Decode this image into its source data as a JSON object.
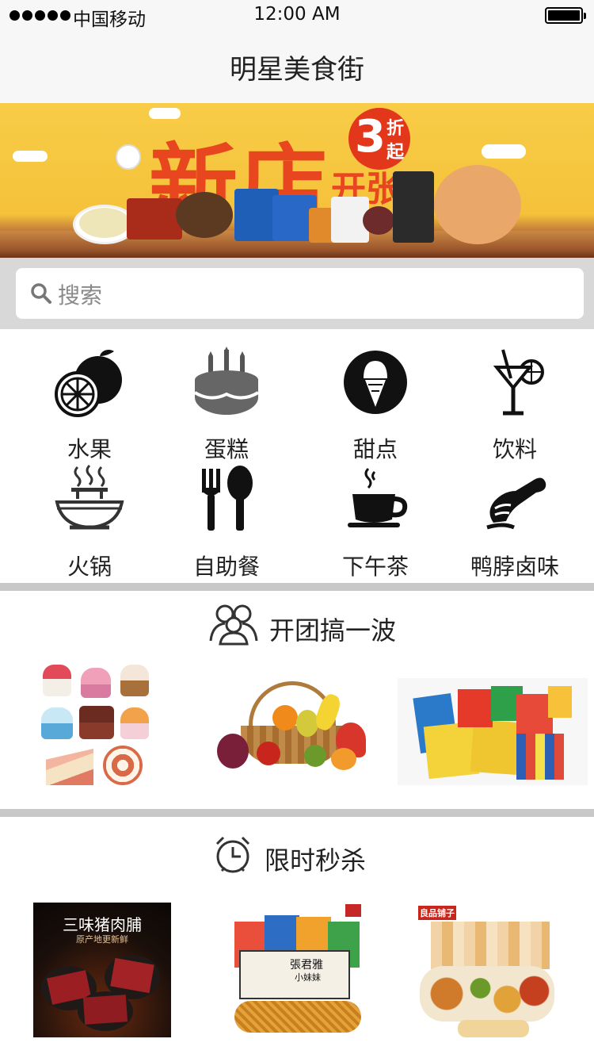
{
  "status_bar": {
    "carrier": "中国移动",
    "time": "12:00 AM",
    "battery_level": 1.0
  },
  "nav": {
    "title": "明星美食街"
  },
  "banner": {
    "headline": "新店",
    "subline": "开张",
    "discount_number": "3",
    "discount_char_1": "折",
    "discount_char_2": "起"
  },
  "search": {
    "placeholder": "搜索"
  },
  "categories": [
    {
      "label": "水果",
      "icon": "orange-icon"
    },
    {
      "label": "蛋糕",
      "icon": "cake-icon"
    },
    {
      "label": "甜点",
      "icon": "ice-cream-icon"
    },
    {
      "label": "饮料",
      "icon": "cocktail-icon"
    },
    {
      "label": "火锅",
      "icon": "hotpot-icon"
    },
    {
      "label": "自助餐",
      "icon": "fork-spoon-icon"
    },
    {
      "label": "下午茶",
      "icon": "teacup-icon"
    },
    {
      "label": "鸭脖卤味",
      "icon": "duck-neck-icon"
    }
  ],
  "group_buy": {
    "title": "开团搞一波",
    "icon": "group-people-icon",
    "items": [
      {
        "name": "cupcakes-image"
      },
      {
        "name": "fruit-basket-image"
      },
      {
        "name": "snacks-image"
      }
    ]
  },
  "flash_sale": {
    "title": "限时秒杀",
    "icon": "alarm-clock-icon",
    "items": [
      {
        "caption": "三味猪肉脯",
        "subcaption": "原产地更新鲜"
      },
      {
        "caption": "張君雅",
        "subcaption": "小妹妹"
      },
      {
        "caption": "良品铺子",
        "subcaption": ""
      }
    ]
  },
  "colors": {
    "banner_yellow": "#f6c43d",
    "banner_red": "#e8461f",
    "divider_gray": "#c8c8c8",
    "search_bg": "#d8d8d8"
  }
}
